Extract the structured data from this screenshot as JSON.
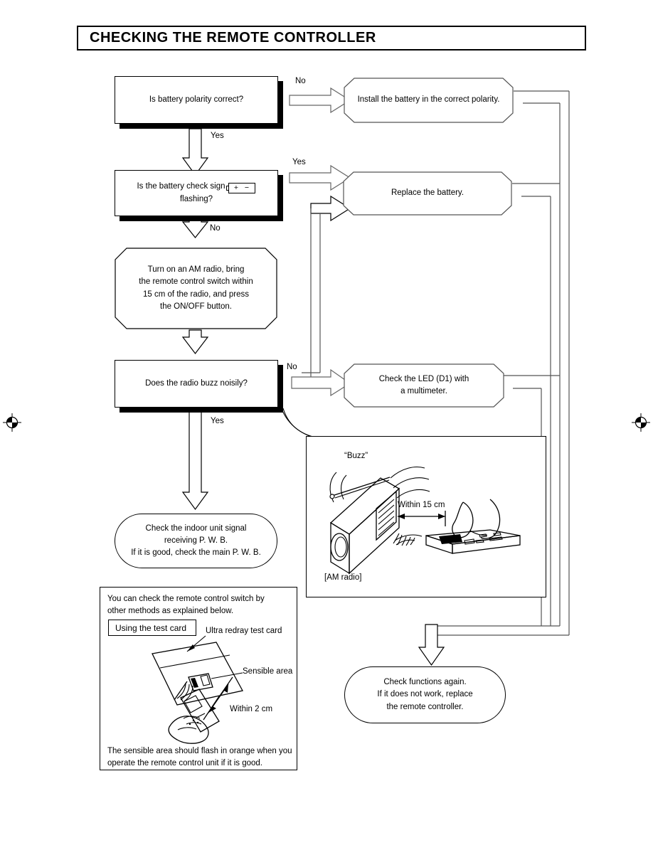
{
  "document": {
    "title": "CHECKING THE  REMOTE  CONTROLLER"
  },
  "flow": {
    "decisions": [
      {
        "id": "d1",
        "text": "Is battery polarity correct?"
      },
      {
        "id": "d2",
        "text_before": "Is the battery check sign",
        "battery_plus": "+",
        "battery_minus": "−",
        "text_after": "flashing?"
      },
      {
        "id": "d3",
        "text": "Does the radio buzz noisily?"
      }
    ],
    "actions": [
      {
        "id": "a1",
        "text": "Install the battery in the correct polarity."
      },
      {
        "id": "a2",
        "text": "Replace the battery."
      },
      {
        "id": "a3",
        "line1": "Check the LED (D1) with",
        "line2": "a multimeter."
      }
    ],
    "instruction": {
      "line1": "Turn on an AM radio, bring",
      "line2": "the remote control switch within",
      "line3": "15 cm of the radio, and press",
      "line4": "the ON/OFF button."
    },
    "terminal_left": {
      "line1": "Check the indoor unit signal",
      "line2": "receiving P. W. B.",
      "line3": "If it is good, check the main P. W. B."
    },
    "terminal_right": {
      "line1": "Check functions again.",
      "line2": "If it does not work, replace",
      "line3": "the remote controller."
    },
    "labels": {
      "no_1": "No",
      "yes_1": "Yes",
      "yes_2": "Yes",
      "no_2": "No",
      "no_3": "No",
      "yes_3": "Yes"
    }
  },
  "radio_figure": {
    "buzz_label": "“Buzz”",
    "distance_label": "Within 15 cm",
    "device_label": "[AM radio]"
  },
  "testcard_panel": {
    "intro_line1": "You can check the remote control switch by",
    "intro_line2": "other methods as explained below.",
    "method_title": "Using the test card",
    "callout_card": "Ultra redray test card",
    "callout_area": "Sensible area",
    "distance_label": "Within 2 cm",
    "footer_line1": "The sensible area should flash in orange when you",
    "footer_line2": "operate the remote control unit if it is good."
  },
  "colors": {
    "ink": "#000000",
    "pipe": "#555555",
    "paper": "#ffffff"
  }
}
